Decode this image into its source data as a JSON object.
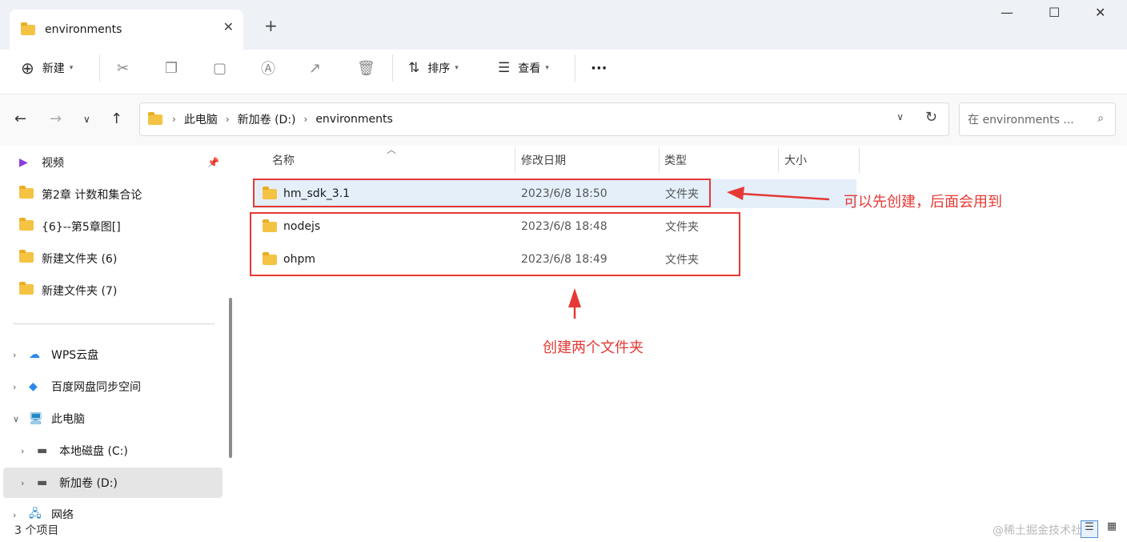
{
  "window": {
    "tab_title": "environments",
    "tab_close": "✕",
    "new_tab": "+",
    "minimize": "—",
    "maximize": "☐",
    "close": "✕"
  },
  "toolbar": {
    "new_label": "新建",
    "sort_label": "排序",
    "view_label": "查看",
    "more": "···"
  },
  "address": {
    "crumbs": [
      "此电脑",
      "新加卷 (D:)",
      "environments"
    ],
    "search_placeholder": "在 environments ..."
  },
  "sidebar": {
    "items": [
      {
        "label": "视频",
        "icon": "video-icon"
      },
      {
        "label": "第2章 计数和集合论",
        "icon": "folder-icon"
      },
      {
        "label": "{6}--第5章图[]",
        "icon": "folder-icon"
      },
      {
        "label": "新建文件夹 (6)",
        "icon": "folder-icon"
      },
      {
        "label": "新建文件夹 (7)",
        "icon": "folder-icon"
      },
      {
        "label": "WPS云盘",
        "icon": "cloud-icon"
      },
      {
        "label": "百度网盘同步空间",
        "icon": "baidu-netdisk-icon"
      },
      {
        "label": "此电脑",
        "icon": "computer-icon"
      },
      {
        "label": "本地磁盘 (C:)",
        "icon": "drive-icon"
      },
      {
        "label": "新加卷 (D:)",
        "icon": "drive-icon"
      },
      {
        "label": "网络",
        "icon": "network-icon"
      }
    ]
  },
  "columns": {
    "name": "名称",
    "modified": "修改日期",
    "type": "类型",
    "size": "大小"
  },
  "files": [
    {
      "name": "hm_sdk_3.1",
      "modified": "2023/6/8 18:50",
      "type": "文件夹"
    },
    {
      "name": "nodejs",
      "modified": "2023/6/8 18:48",
      "type": "文件夹"
    },
    {
      "name": "ohpm",
      "modified": "2023/6/8 18:49",
      "type": "文件夹"
    }
  ],
  "annotations": {
    "right_note": "可以先创建，后面会用到",
    "bottom_note": "创建两个文件夹"
  },
  "status": {
    "count": "3 个项目",
    "watermark": "@稀土掘金技术社区"
  },
  "colors": {
    "annotation": "#e53935",
    "selected_row": "#e4effa",
    "folder": "#f5c343"
  }
}
